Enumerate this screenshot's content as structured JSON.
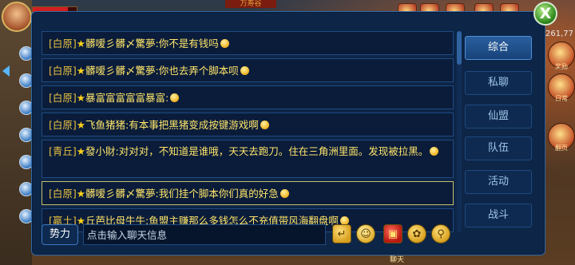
{
  "hud": {
    "top_title": "万寿谷",
    "coord": "261,77",
    "right_labels": [
      "奖励",
      "日常",
      "翻页"
    ],
    "bottom_label": "聊天"
  },
  "close_button": {
    "label": "X"
  },
  "messages": [
    {
      "channel": "[白原]",
      "sender": "髒嗳彡髒〆驚夢",
      "text": "你不是有钱吗",
      "emoji": true,
      "selected": false
    },
    {
      "channel": "[白原]",
      "sender": "髒嗳彡髒〆驚夢",
      "text": "你也去弄个脚本呗",
      "emoji": true,
      "selected": false
    },
    {
      "channel": "[白原]",
      "sender": "暴富富富富富暴富",
      "text": "",
      "emoji": true,
      "selected": false
    },
    {
      "channel": "[白原]",
      "sender": "飞鱼猪猪",
      "text": "有本事把黑猪变成按键游戏啊",
      "emoji": true,
      "selected": false
    },
    {
      "channel": "[青丘]",
      "sender": "發小財",
      "text": "对对对，不知道是谁哦，天天去跑刀。住在三角洲里面。发现被拉黑。",
      "emoji": true,
      "selected": false
    },
    {
      "channel": "[白原]",
      "sender": "髒嗳彡髒〆驚夢",
      "text": "我们挂个脚本你们真的好急",
      "emoji": true,
      "selected": true
    },
    {
      "channel": "[嬴土]",
      "sender": "丘芭比母牛牛",
      "text": "鱼盟主赚那么多钱怎么不充值带风海翻盘啊",
      "emoji": true,
      "selected": false
    }
  ],
  "tabs": [
    {
      "label": "综合",
      "active": true
    },
    {
      "label": "私聊",
      "active": false
    },
    {
      "label": "仙盟",
      "active": false
    },
    {
      "label": "队伍",
      "active": false
    },
    {
      "label": "活动",
      "active": false
    },
    {
      "label": "战斗",
      "active": false
    }
  ],
  "input": {
    "channel_label": "势力",
    "placeholder": "点击输入聊天信息",
    "value": ""
  },
  "toolbar": {
    "icons": [
      "return-icon",
      "emoji-icon",
      "gift-icon",
      "settings-icon",
      "location-icon"
    ]
  },
  "colors": {
    "panel_bg": "#0d2547",
    "message_text": "#ffe56a",
    "tab_active": "#2a5f9e",
    "selected_border": "#c9c06a"
  }
}
